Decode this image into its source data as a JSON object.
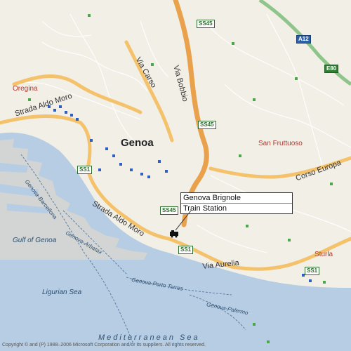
{
  "map": {
    "city_label": "Genoa",
    "districts": [
      {
        "id": "oregina",
        "label": "Oregina"
      },
      {
        "id": "san-fruttuoso",
        "label": "San Fruttuoso"
      },
      {
        "id": "sturla",
        "label": "Sturla"
      }
    ],
    "roads": [
      {
        "id": "strada-aldo-moro-north",
        "label": "Strada Aldo Moro"
      },
      {
        "id": "strada-aldo-moro-south",
        "label": "Strada Aldo Moro"
      },
      {
        "id": "via-carso",
        "label": "Via Carso"
      },
      {
        "id": "via-bobbio",
        "label": "Via Bobbio"
      },
      {
        "id": "corso-europa",
        "label": "Corso Europa"
      },
      {
        "id": "via-aurelia",
        "label": "Via Aurelia"
      }
    ],
    "water_labels": [
      {
        "id": "gulf-of-genoa",
        "label": "Gulf of Genoa"
      },
      {
        "id": "ligurian-sea",
        "label": "Ligurian Sea"
      },
      {
        "id": "mediterranean-sea",
        "label": "Mediterranean Sea"
      },
      {
        "id": "route-barcelona",
        "label": "Genova-Barcellona"
      },
      {
        "id": "route-arbatax",
        "label": "Genova-Arbatax"
      },
      {
        "id": "route-porto-torres",
        "label": "Genova-Porto Torres"
      },
      {
        "id": "route-palermo",
        "label": "Genova-Palermo"
      }
    ],
    "shields": [
      {
        "id": "ss45-north",
        "label": "SS45"
      },
      {
        "id": "ss45-mid",
        "label": "SS45"
      },
      {
        "id": "ss45-south",
        "label": "SS45"
      },
      {
        "id": "ss1-west",
        "label": "SS1"
      },
      {
        "id": "ss1-center",
        "label": "SS1"
      },
      {
        "id": "ss1-east",
        "label": "SS1"
      },
      {
        "id": "a12",
        "label": "A12"
      },
      {
        "id": "e80",
        "label": "E80"
      }
    ],
    "callout": {
      "line1": "Genova Brignole",
      "line2": "Train Station"
    },
    "copyright": "Copyright © and (P) 1988–2006 Microsoft Corporation and/or its suppliers. All rights reserved.",
    "colors": {
      "land": "#f2efe7",
      "sea": "#b7cde3",
      "major_road": "#f4c26b",
      "highway": "#e9a24b",
      "motorway": "#8fc58a",
      "district_text": "#b03a30"
    },
    "icons": {
      "marker": "train-station-pin-icon",
      "poi": "poi-square-icon"
    }
  }
}
